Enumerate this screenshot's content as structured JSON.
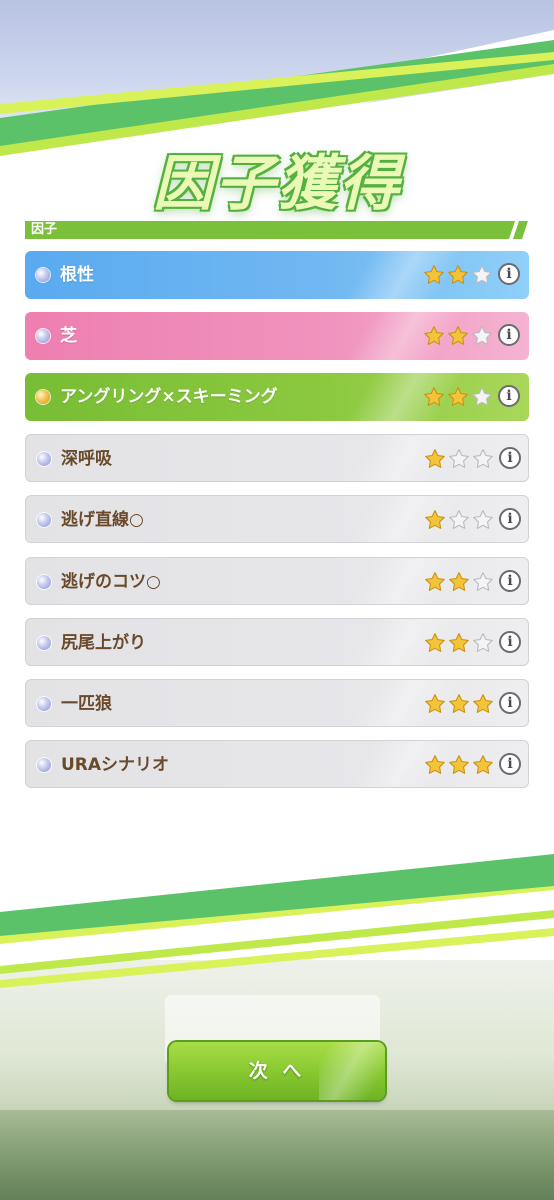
{
  "screen": {
    "title": "因子獲得"
  },
  "section": {
    "label": "因子"
  },
  "factors": [
    {
      "name": "根性",
      "type": "blue",
      "stars": 2,
      "dot": "blue"
    },
    {
      "name": "芝",
      "type": "pink",
      "stars": 2,
      "dot": "blue"
    },
    {
      "name": "アングリング×スキーミング",
      "type": "green",
      "stars": 2,
      "dot": "gold"
    },
    {
      "name": "深呼吸",
      "type": "gray",
      "stars": 1,
      "dot": "blue"
    },
    {
      "name": "逃げ直線○",
      "type": "gray",
      "stars": 1,
      "dot": "blue"
    },
    {
      "name": "逃げのコツ○",
      "type": "gray",
      "stars": 2,
      "dot": "blue"
    },
    {
      "name": "尻尾上がり",
      "type": "gray",
      "stars": 2,
      "dot": "blue"
    },
    {
      "name": "一匹狼",
      "type": "gray",
      "stars": 3,
      "dot": "blue"
    },
    {
      "name": "URAシナリオ",
      "type": "gray",
      "stars": 3,
      "dot": "blue"
    }
  ],
  "stars_max": 3,
  "info_glyph": "i",
  "buttons": {
    "next_label": "次 へ"
  },
  "colors": {
    "accent_green": "#86c730",
    "stripe_green": "#5cb85c",
    "stripe_lime": "#d9f25a",
    "star_gold": "#f3c43a"
  }
}
